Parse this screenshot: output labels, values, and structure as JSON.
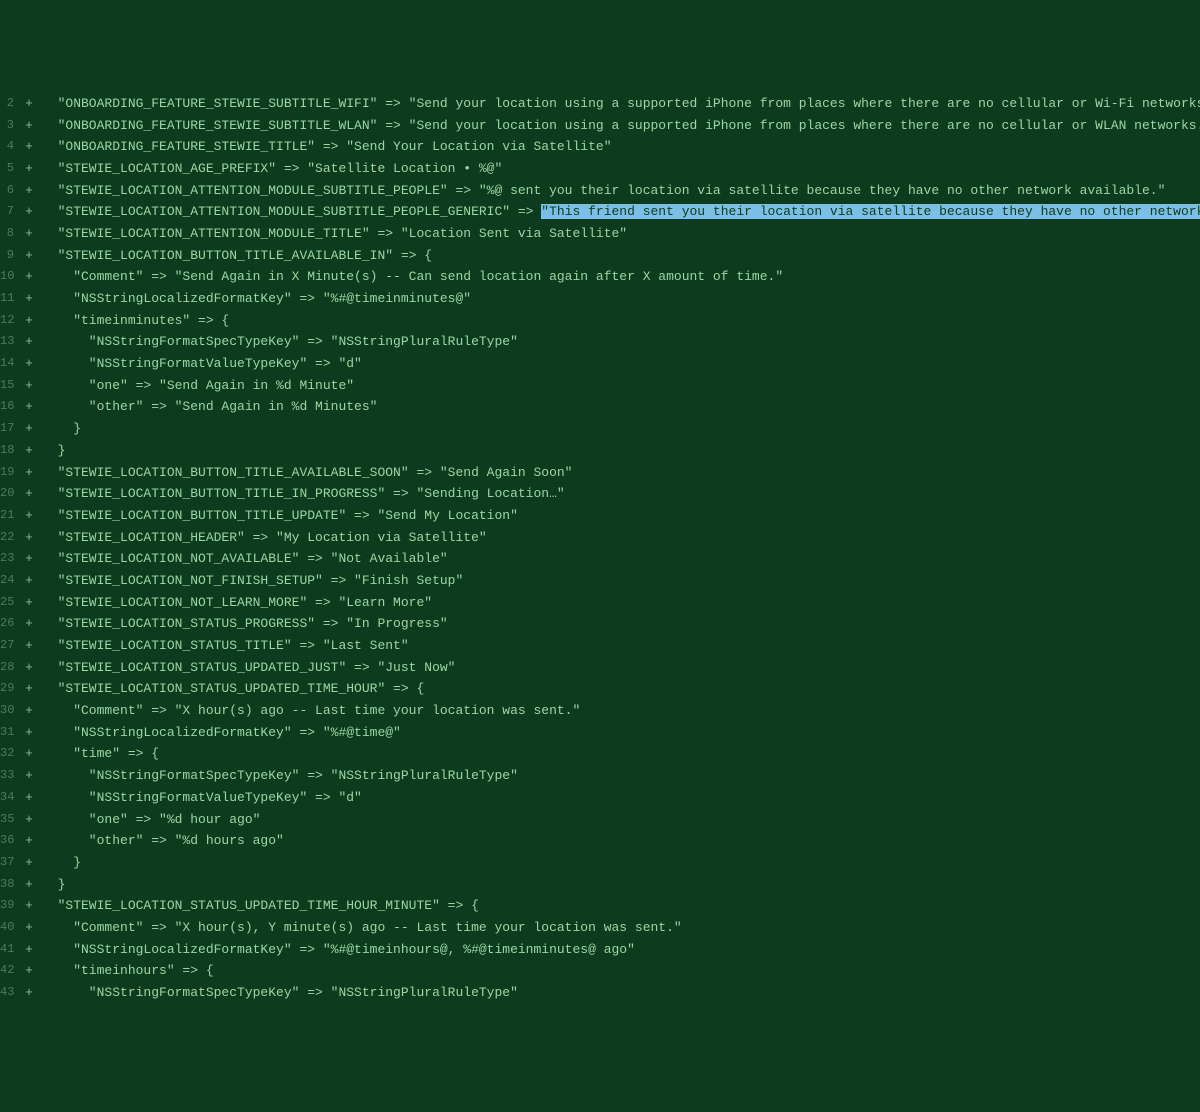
{
  "lines": [
    {
      "num": "2",
      "mark": "+",
      "indent": 1,
      "text": "\"ONBOARDING_FEATURE_STEWIE_SUBTITLE_WIFI\" => \"Send your location using a supported iPhone from places where there are no cellular or Wi-Fi networks.\""
    },
    {
      "num": "3",
      "mark": "+",
      "indent": 1,
      "text": "\"ONBOARDING_FEATURE_STEWIE_SUBTITLE_WLAN\" => \"Send your location using a supported iPhone from places where there are no cellular or WLAN networks.\""
    },
    {
      "num": "4",
      "mark": "+",
      "indent": 1,
      "text": "\"ONBOARDING_FEATURE_STEWIE_TITLE\" => \"Send Your Location via Satellite\""
    },
    {
      "num": "5",
      "mark": "+",
      "indent": 1,
      "text": "\"STEWIE_LOCATION_AGE_PREFIX\" => \"Satellite Location • %@\""
    },
    {
      "num": "6",
      "mark": "+",
      "indent": 1,
      "text": "\"STEWIE_LOCATION_ATTENTION_MODULE_SUBTITLE_PEOPLE\" => \"%@ sent you their location via satellite because they have no other network available.\""
    },
    {
      "num": "7",
      "mark": "+",
      "indent": 1,
      "pre": "\"STEWIE_LOCATION_ATTENTION_MODULE_SUBTITLE_PEOPLE_GENERIC\" => ",
      "hl": "\"This friend sent you their location via satellite because they have no other network available.",
      "post": "\""
    },
    {
      "num": "8",
      "mark": "+",
      "indent": 1,
      "text": "\"STEWIE_LOCATION_ATTENTION_MODULE_TITLE\" => \"Location Sent via Satellite\""
    },
    {
      "num": "9",
      "mark": "+",
      "indent": 1,
      "text": "\"STEWIE_LOCATION_BUTTON_TITLE_AVAILABLE_IN\" => {"
    },
    {
      "num": "10",
      "mark": "+",
      "indent": 2,
      "text": "\"Comment\" => \"Send Again in X Minute(s) -- Can send location again after X amount of time.\""
    },
    {
      "num": "11",
      "mark": "+",
      "indent": 2,
      "text": "\"NSStringLocalizedFormatKey\" => \"%#@timeinminutes@\""
    },
    {
      "num": "12",
      "mark": "+",
      "indent": 2,
      "text": "\"timeinminutes\" => {"
    },
    {
      "num": "13",
      "mark": "+",
      "indent": 3,
      "text": "\"NSStringFormatSpecTypeKey\" => \"NSStringPluralRuleType\""
    },
    {
      "num": "14",
      "mark": "+",
      "indent": 3,
      "text": "\"NSStringFormatValueTypeKey\" => \"d\""
    },
    {
      "num": "15",
      "mark": "+",
      "indent": 3,
      "text": "\"one\" => \"Send Again in %d Minute\""
    },
    {
      "num": "16",
      "mark": "+",
      "indent": 3,
      "text": "\"other\" => \"Send Again in %d Minutes\""
    },
    {
      "num": "17",
      "mark": "+",
      "indent": 2,
      "text": "}"
    },
    {
      "num": "18",
      "mark": "+",
      "indent": 1,
      "text": "}"
    },
    {
      "num": "19",
      "mark": "+",
      "indent": 1,
      "text": "\"STEWIE_LOCATION_BUTTON_TITLE_AVAILABLE_SOON\" => \"Send Again Soon\""
    },
    {
      "num": "20",
      "mark": "+",
      "indent": 1,
      "text": "\"STEWIE_LOCATION_BUTTON_TITLE_IN_PROGRESS\" => \"Sending Location…\""
    },
    {
      "num": "21",
      "mark": "+",
      "indent": 1,
      "text": "\"STEWIE_LOCATION_BUTTON_TITLE_UPDATE\" => \"Send My Location\""
    },
    {
      "num": "22",
      "mark": "+",
      "indent": 1,
      "text": "\"STEWIE_LOCATION_HEADER\" => \"My Location via Satellite\""
    },
    {
      "num": "23",
      "mark": "+",
      "indent": 1,
      "text": "\"STEWIE_LOCATION_NOT_AVAILABLE\" => \"Not Available\""
    },
    {
      "num": "24",
      "mark": "+",
      "indent": 1,
      "text": "\"STEWIE_LOCATION_NOT_FINISH_SETUP\" => \"Finish Setup\""
    },
    {
      "num": "25",
      "mark": "+",
      "indent": 1,
      "text": "\"STEWIE_LOCATION_NOT_LEARN_MORE\" => \"Learn More\""
    },
    {
      "num": "26",
      "mark": "+",
      "indent": 1,
      "text": "\"STEWIE_LOCATION_STATUS_PROGRESS\" => \"In Progress\""
    },
    {
      "num": "27",
      "mark": "+",
      "indent": 1,
      "text": "\"STEWIE_LOCATION_STATUS_TITLE\" => \"Last Sent\""
    },
    {
      "num": "28",
      "mark": "+",
      "indent": 1,
      "text": "\"STEWIE_LOCATION_STATUS_UPDATED_JUST\" => \"Just Now\""
    },
    {
      "num": "29",
      "mark": "+",
      "indent": 1,
      "text": "\"STEWIE_LOCATION_STATUS_UPDATED_TIME_HOUR\" => {"
    },
    {
      "num": "30",
      "mark": "+",
      "indent": 2,
      "text": "\"Comment\" => \"X hour(s) ago -- Last time your location was sent.\""
    },
    {
      "num": "31",
      "mark": "+",
      "indent": 2,
      "text": "\"NSStringLocalizedFormatKey\" => \"%#@time@\""
    },
    {
      "num": "32",
      "mark": "+",
      "indent": 2,
      "text": "\"time\" => {"
    },
    {
      "num": "33",
      "mark": "+",
      "indent": 3,
      "text": "\"NSStringFormatSpecTypeKey\" => \"NSStringPluralRuleType\""
    },
    {
      "num": "34",
      "mark": "+",
      "indent": 3,
      "text": "\"NSStringFormatValueTypeKey\" => \"d\""
    },
    {
      "num": "35",
      "mark": "+",
      "indent": 3,
      "text": "\"one\" => \"%d hour ago\""
    },
    {
      "num": "36",
      "mark": "+",
      "indent": 3,
      "text": "\"other\" => \"%d hours ago\""
    },
    {
      "num": "37",
      "mark": "+",
      "indent": 2,
      "text": "}"
    },
    {
      "num": "38",
      "mark": "+",
      "indent": 1,
      "text": "}"
    },
    {
      "num": "39",
      "mark": "+",
      "indent": 1,
      "text": "\"STEWIE_LOCATION_STATUS_UPDATED_TIME_HOUR_MINUTE\" => {"
    },
    {
      "num": "40",
      "mark": "+",
      "indent": 2,
      "text": "\"Comment\" => \"X hour(s), Y minute(s) ago -- Last time your location was sent.\""
    },
    {
      "num": "41",
      "mark": "+",
      "indent": 2,
      "text": "\"NSStringLocalizedFormatKey\" => \"%#@timeinhours@, %#@timeinminutes@ ago\""
    },
    {
      "num": "42",
      "mark": "+",
      "indent": 2,
      "text": "\"timeinhours\" => {"
    },
    {
      "num": "43",
      "mark": "+",
      "indent": 3,
      "text": "\"NSStringFormatSpecTypeKey\" => \"NSStringPluralRuleType\""
    }
  ],
  "indentUnit": "  "
}
